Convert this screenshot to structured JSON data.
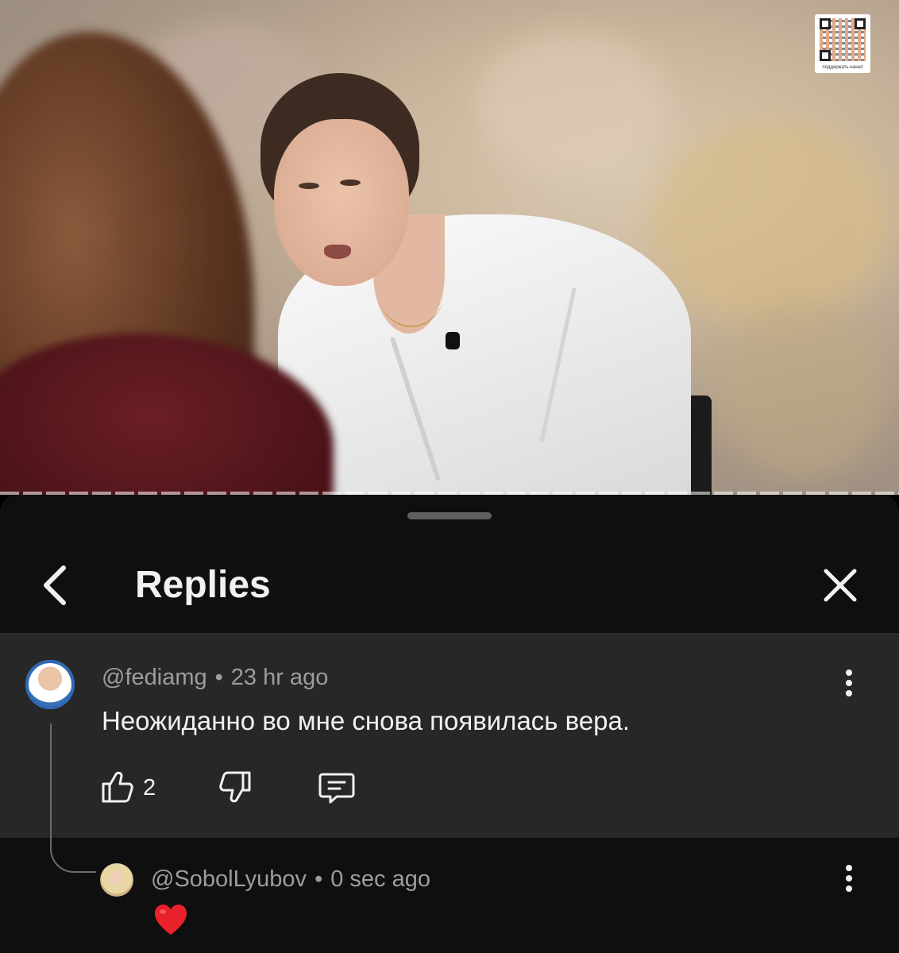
{
  "video": {
    "qr_caption": "поддержать канал"
  },
  "sheet": {
    "title": "Replies"
  },
  "comment": {
    "author": "@fediamg",
    "separator": "•",
    "time": "23 hr ago",
    "text": "Неожиданно во мне снова появилась вера.",
    "like_count": "2",
    "icons": [
      "thumbs-up-icon",
      "thumbs-down-icon",
      "reply-icon",
      "more-vertical-icon"
    ]
  },
  "reply": {
    "author": "@SobolLyubov",
    "separator": "•",
    "time": "0 sec ago",
    "content_icon": "red-heart-emoji"
  },
  "colors": {
    "sheet_bg": "#0f0f0f",
    "comment_bg": "#272727",
    "secondary_text": "#9d9d9d",
    "primary_text": "#f1f1f1",
    "heart": "#e8212b"
  }
}
